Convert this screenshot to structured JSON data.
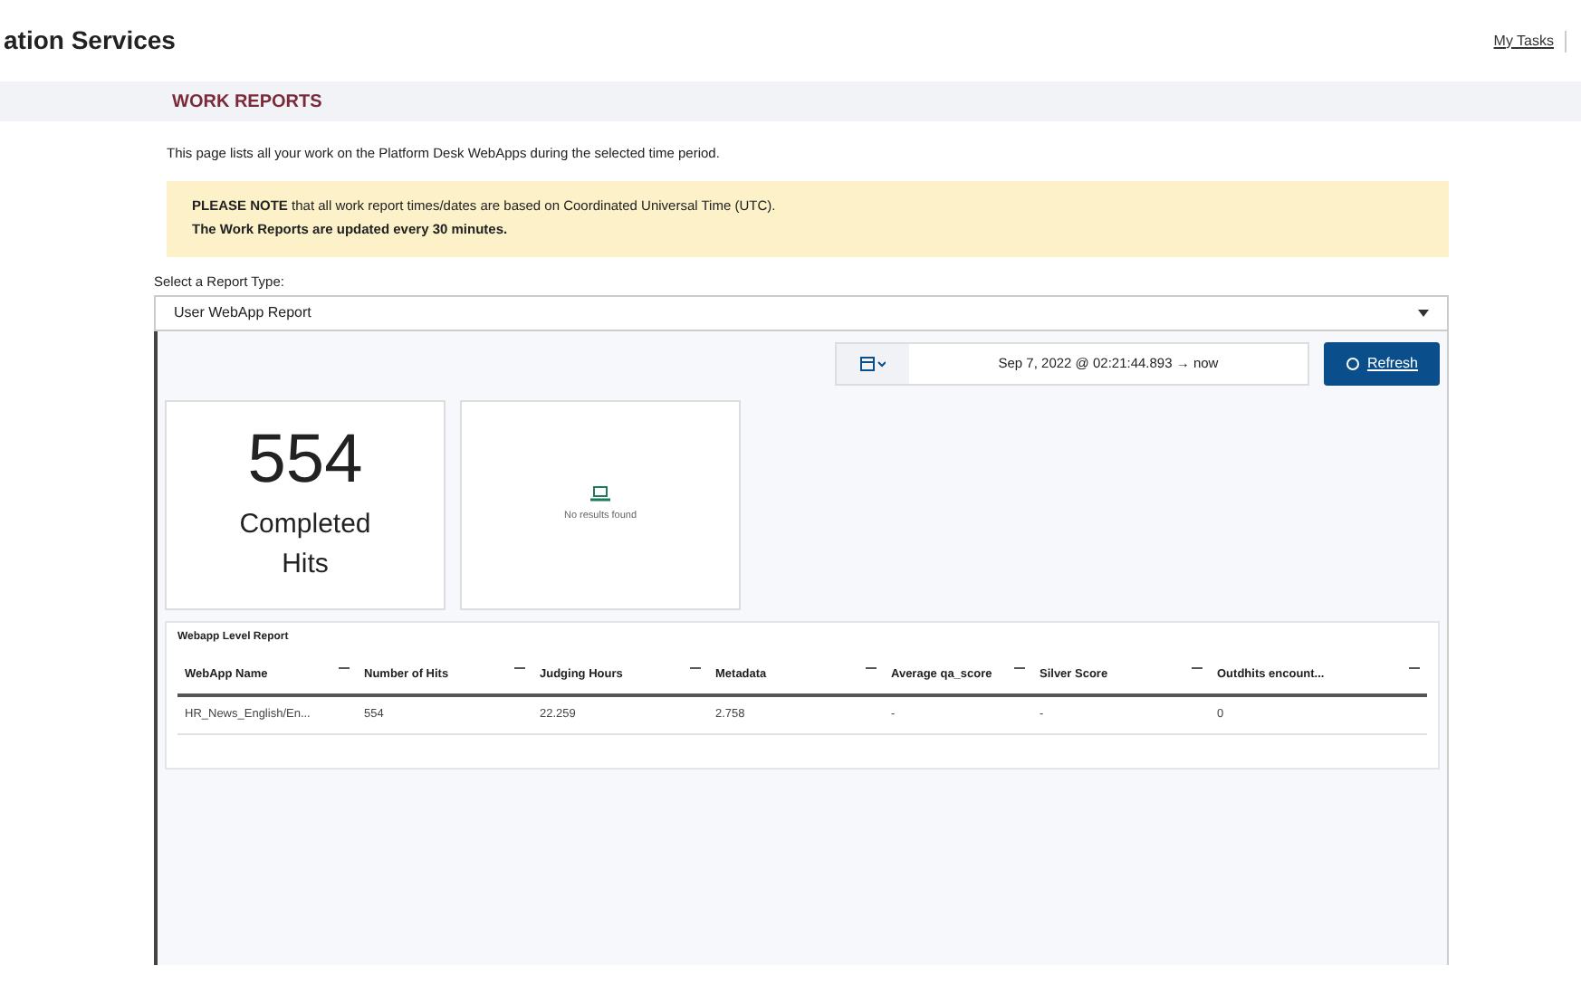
{
  "header": {
    "title": "ation Services",
    "link": "My Tasks"
  },
  "page_title": "WORK REPORTS",
  "intro": "This page lists all your work on the Platform Desk WebApps during the selected time period.",
  "notice": [
    "**PLEASE NOTE** that all work report times/dates are based on Coordinated Universal Time (UTC).",
    "The Work Reports are updated every 30 minutes."
  ],
  "report_type": {
    "label": "Select a Report Type:",
    "value": "User WebApp Report"
  },
  "time_range": {
    "value": "Sep 7, 2022 @ 02:21:44.893",
    "arrow": "→",
    "end": "now"
  },
  "refresh_button": "Refresh",
  "metric": {
    "value": "554",
    "label": "Completed Hits"
  },
  "empty_panel": "No results found",
  "table": {
    "title": "Webapp Level Report",
    "columns": [
      "WebApp Name",
      "Number of Hits",
      "Judging Hours",
      "Metadata",
      "Average qa_score",
      "Silver Score",
      "Outdhits encount..."
    ],
    "rows": [
      [
        "HR_News_English/En...",
        "554",
        "22.259",
        "2.758",
        "-",
        "-",
        "0"
      ]
    ]
  }
}
